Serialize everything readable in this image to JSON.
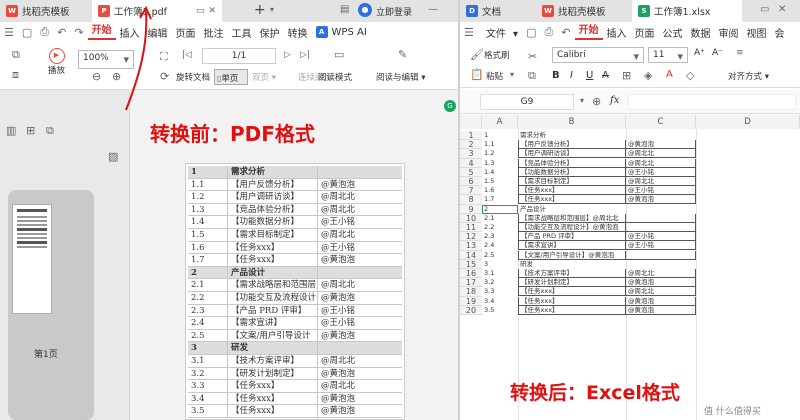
{
  "left": {
    "tabs": [
      {
        "label": "找稻壳模板"
      },
      {
        "label": "工作簿1.pdf"
      }
    ],
    "tab_add": "+",
    "login": "立即登录",
    "menu": {
      "items": [
        "开始",
        "插入",
        "编辑",
        "页面",
        "批注",
        "工具",
        "保护",
        "转换"
      ],
      "wps_ai": "WPS AI"
    },
    "toolbar": {
      "play": "播放",
      "zoom": "100%",
      "page": "1/1",
      "rotate": "旋转文档",
      "single": "单页",
      "double": "双页",
      "continuous": "连续阅读",
      "read_mode": "阅读模式",
      "read_edit": "阅读与编辑"
    },
    "thumb_label": "第1页",
    "banner": "转换前：PDF格式",
    "pdf_rows": [
      {
        "n": "1",
        "t": "需求分析",
        "p": "",
        "sec": true
      },
      {
        "n": "1.1",
        "t": "【用户反馈分析】",
        "p": "@黄泡泡"
      },
      {
        "n": "1.2",
        "t": "【用户调研访谈】",
        "p": "@周北北"
      },
      {
        "n": "1.3",
        "t": "【竞品体验分析】",
        "p": "@周北北"
      },
      {
        "n": "1.4",
        "t": "【功能数据分析】",
        "p": "@王小铭"
      },
      {
        "n": "1.5",
        "t": "【需求目标制定】",
        "p": "@周北北"
      },
      {
        "n": "1.6",
        "t": "【任务xxx】",
        "p": "@王小铭"
      },
      {
        "n": "1.7",
        "t": "【任务xxx】",
        "p": "@黄泡泡"
      },
      {
        "n": "2",
        "t": "产品设计",
        "p": "",
        "sec": true
      },
      {
        "n": "2.1",
        "t": "【需求战略层和范围层",
        "p": "@周北北"
      },
      {
        "n": "2.2",
        "t": "【功能交互及流程设计",
        "p": "@黄泡泡"
      },
      {
        "n": "2.3",
        "t": "【产品 PRD 评审】",
        "p": "@王小铭"
      },
      {
        "n": "2.4",
        "t": "【需求宣讲】",
        "p": "@王小铭"
      },
      {
        "n": "2.5",
        "t": "【文案/用户引导设计",
        "p": "@黄泡泡"
      },
      {
        "n": "3",
        "t": "研发",
        "p": "",
        "sec": true
      },
      {
        "n": "3.1",
        "t": "【技术方案评审】",
        "p": "@周北北"
      },
      {
        "n": "3.2",
        "t": "【研发计划制定】",
        "p": "@黄泡泡"
      },
      {
        "n": "3.3",
        "t": "【任务xxx】",
        "p": "@周北北"
      },
      {
        "n": "3.4",
        "t": "【任务xxx】",
        "p": "@黄泡泡"
      },
      {
        "n": "3.5",
        "t": "【任务xxx】",
        "p": "@黄泡泡"
      }
    ]
  },
  "right": {
    "tabs": [
      {
        "label": "文档"
      },
      {
        "label": "找稻壳模板"
      },
      {
        "label": "工作簿1.xlsx"
      }
    ],
    "menu": {
      "file": "文件",
      "items": [
        "开始",
        "插入",
        "页面",
        "公式",
        "数据",
        "审阅",
        "视图",
        "会"
      ]
    },
    "toolbar": {
      "format_painter": "格式刷",
      "paste": "粘贴",
      "font": "Calibri",
      "size": "11",
      "align": "对齐方式"
    },
    "cell_ref": "G9",
    "fx": "fx",
    "columns": [
      "A",
      "B",
      "C",
      "D"
    ],
    "rows": [
      {
        "r": "1",
        "a": "1",
        "b": "需求分析",
        "c": "",
        "sec": true
      },
      {
        "r": "2",
        "a": "1.1",
        "b": "【用户反馈分析】",
        "c": "@黄泡泡"
      },
      {
        "r": "3",
        "a": "1.2",
        "b": "【用户调研访谈】",
        "c": "@周北北"
      },
      {
        "r": "4",
        "a": "1.3",
        "b": "【竞品体验分析】",
        "c": "@周北北"
      },
      {
        "r": "5",
        "a": "1.4",
        "b": "【功能数据分析】",
        "c": "@王小铭"
      },
      {
        "r": "6",
        "a": "1.5",
        "b": "【需求目标制定】",
        "c": "@周北北"
      },
      {
        "r": "7",
        "a": "1.6",
        "b": "【任务xxx】",
        "c": "@王小铭"
      },
      {
        "r": "8",
        "a": "1.7",
        "b": "【任务xxx】",
        "c": "@黄泡泡"
      },
      {
        "r": "9",
        "a": "2",
        "b": "产品设计",
        "c": "",
        "sec": true
      },
      {
        "r": "10",
        "a": "2.1",
        "b": "【需求战略层和范围层】@周北北",
        "c": ""
      },
      {
        "r": "11",
        "a": "2.2",
        "b": "【功能交互及流程设计】@黄泡泡",
        "c": ""
      },
      {
        "r": "12",
        "a": "2.3",
        "b": "【产品 PRD 评审】",
        "c": "@王小铭"
      },
      {
        "r": "13",
        "a": "2.4",
        "b": "【需求宣讲】",
        "c": "@王小铭"
      },
      {
        "r": "14",
        "a": "2.5",
        "b": "【文案/用户引导设计】@黄泡泡",
        "c": ""
      },
      {
        "r": "15",
        "a": "3",
        "b": "研发",
        "c": "",
        "sec": true
      },
      {
        "r": "16",
        "a": "3.1",
        "b": "【技术方案评审】",
        "c": "@周北北"
      },
      {
        "r": "17",
        "a": "3.2",
        "b": "【研发计划制定】",
        "c": "@黄泡泡"
      },
      {
        "r": "18",
        "a": "3.3",
        "b": "【任务xxx】",
        "c": "@周北北"
      },
      {
        "r": "19",
        "a": "3.4",
        "b": "【任务xxx】",
        "c": "@黄泡泡"
      },
      {
        "r": "20",
        "a": "3.5",
        "b": "【任务xxx】",
        "c": "@黄泡泡"
      }
    ],
    "banner": "转换后：Excel格式",
    "watermark": "值 什么值得买"
  },
  "colors": {
    "red": "#e01010",
    "wps_red": "#d33",
    "excel_green": "#1aa260"
  }
}
